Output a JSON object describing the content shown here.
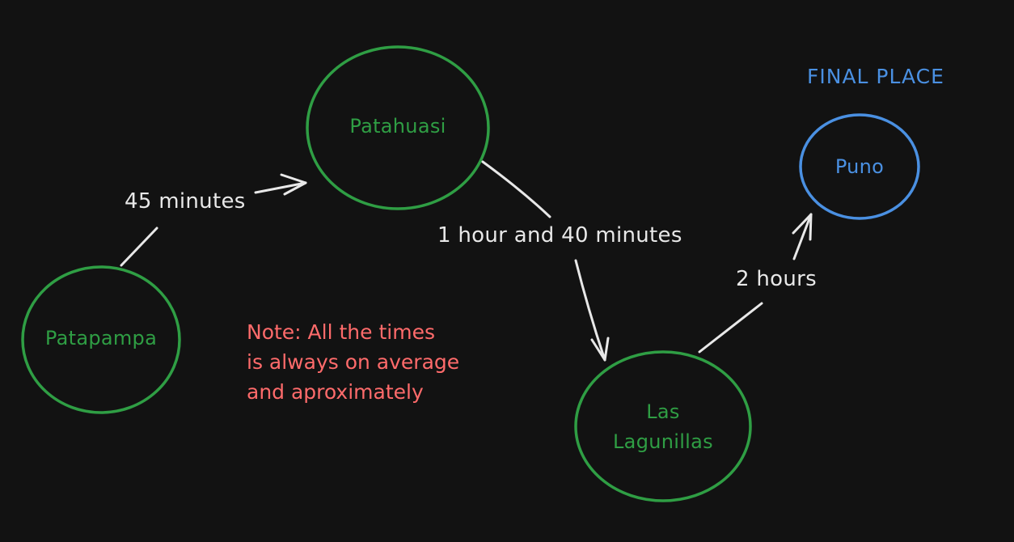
{
  "colors": {
    "background": "#121212",
    "node_green": "#2f9e44",
    "node_blue": "#4a90e2",
    "edge": "#e8e8e8",
    "note": "#ff6b6b"
  },
  "nodes": {
    "patapampa": "Patapampa",
    "patahuasi": "Patahuasi",
    "las_lagunillas": {
      "line1": "Las",
      "line2": "Lagunillas"
    },
    "puno": "Puno"
  },
  "edges": {
    "patapampa_patahuasi": "45 minutes",
    "patahuasi_lagunillas": "1 hour and 40 minutes",
    "lagunillas_puno": "2 hours"
  },
  "final_place_label": "FINAL PLACE",
  "note": {
    "line1": "Note: All the times",
    "line2": "is always on average",
    "line3": "and aproximately"
  }
}
